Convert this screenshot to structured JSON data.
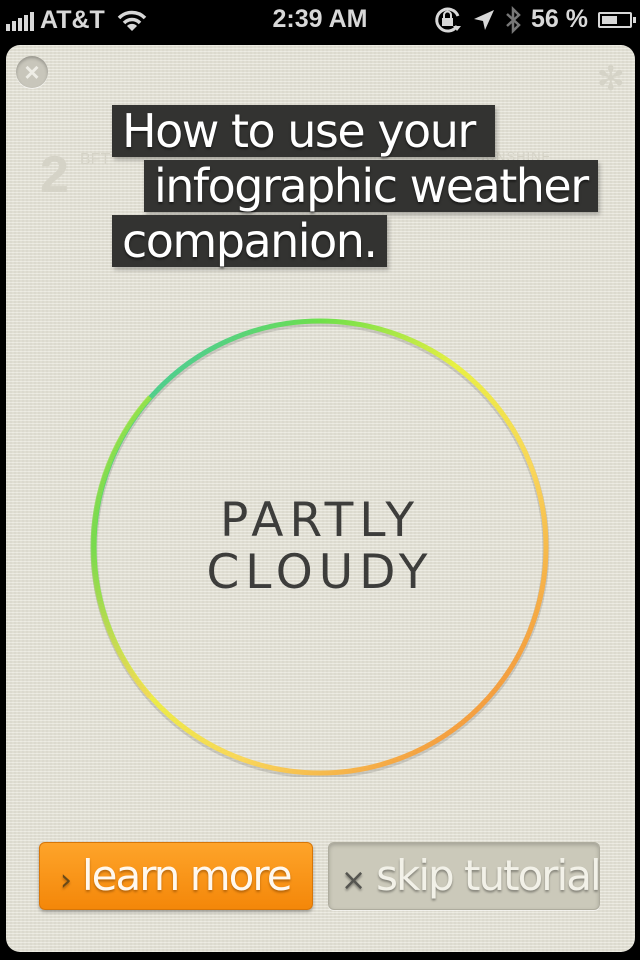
{
  "status_bar": {
    "carrier": "AT&T",
    "time": "2:39 AM",
    "battery_percent_label": "56 %",
    "battery_level": 0.56,
    "icons": [
      "signal-icon",
      "wifi-icon",
      "rotation-lock-icon",
      "location-icon",
      "bluetooth-icon",
      "battery-icon"
    ]
  },
  "background_ghost": {
    "wind_value": "2",
    "wind_unit": "BFT",
    "sunshine_label": "SUNSHINE"
  },
  "tutorial": {
    "close_glyph": "×",
    "headline_lines": [
      "How to use your",
      "infographic weather",
      "companion."
    ],
    "condition_lines": [
      "PARTLY",
      "CLOUDY"
    ],
    "ring_gradient_colors": [
      "#29b6e6",
      "#6ee04a",
      "#e9f043",
      "#f9d65a",
      "#f4a040",
      "#f08a3a"
    ]
  },
  "buttons": {
    "learn_more": {
      "glyph": "›",
      "label": "learn more",
      "color": "#f79414"
    },
    "skip_tutorial": {
      "glyph": "×",
      "label": "skip tutorial",
      "color": "#cbc9ba"
    }
  }
}
